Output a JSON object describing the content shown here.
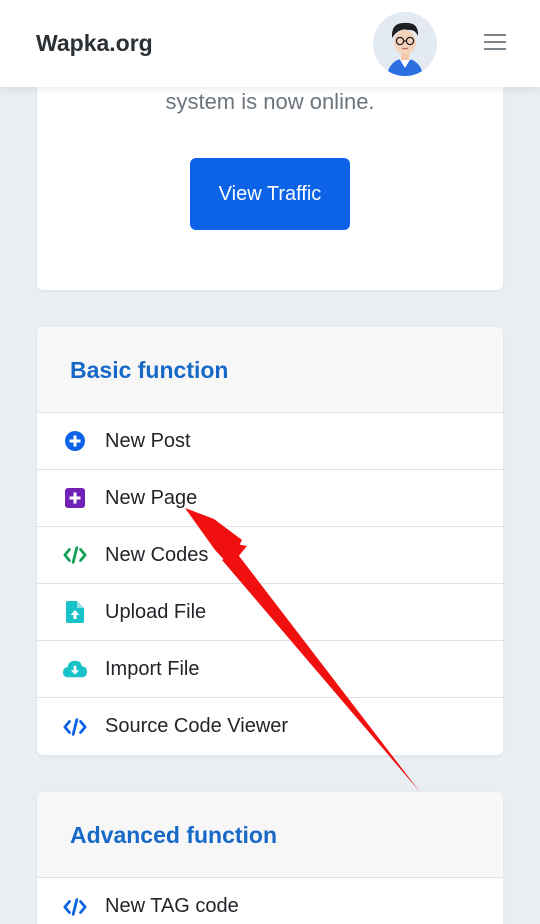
{
  "header": {
    "brand": "Wapka.org"
  },
  "top_card": {
    "status_text": "system is now online.",
    "button_label": "View Traffic"
  },
  "basic": {
    "title": "Basic function",
    "items": [
      {
        "label": "New Post",
        "icon": "plus-circle-icon",
        "color": "#0d63e8"
      },
      {
        "label": "New Page",
        "icon": "plus-square-icon",
        "color": "#6f22b5"
      },
      {
        "label": "New Codes",
        "icon": "code-icon",
        "color": "#15a058"
      },
      {
        "label": "Upload File",
        "icon": "file-upload-icon",
        "color": "#17c3c8"
      },
      {
        "label": "Import File",
        "icon": "cloud-download-icon",
        "color": "#17c3c8"
      },
      {
        "label": "Source Code Viewer",
        "icon": "code-icon",
        "color": "#0d63e8"
      }
    ]
  },
  "advanced": {
    "title": "Advanced function",
    "items": [
      {
        "label": "New TAG code",
        "icon": "code-icon",
        "color": "#0d63e8"
      }
    ]
  },
  "colors": {
    "accent": "#0d63e8",
    "heading": "#1769c8",
    "arrow": "#f01010"
  }
}
